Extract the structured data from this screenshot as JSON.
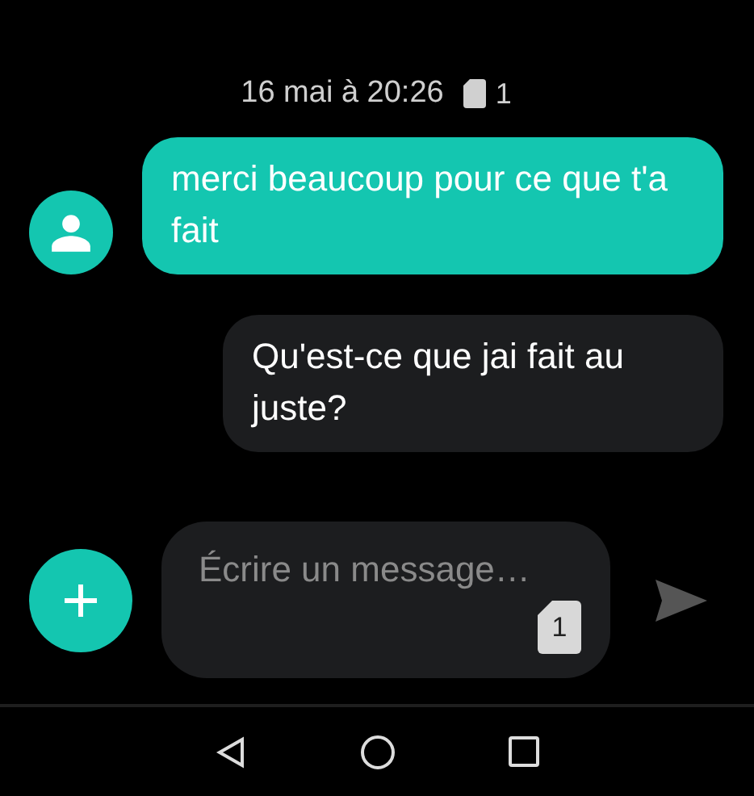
{
  "timestamp": {
    "text": "16 mai à 20:26",
    "sim": "1"
  },
  "messages": [
    {
      "kind": "incoming",
      "text": "merci beaucoup pour ce que t'a fait"
    },
    {
      "kind": "outgoing",
      "text": "Qu'est-ce que jai fait au juste?"
    }
  ],
  "composer": {
    "placeholder": "Écrire un message…",
    "sim": "1"
  }
}
